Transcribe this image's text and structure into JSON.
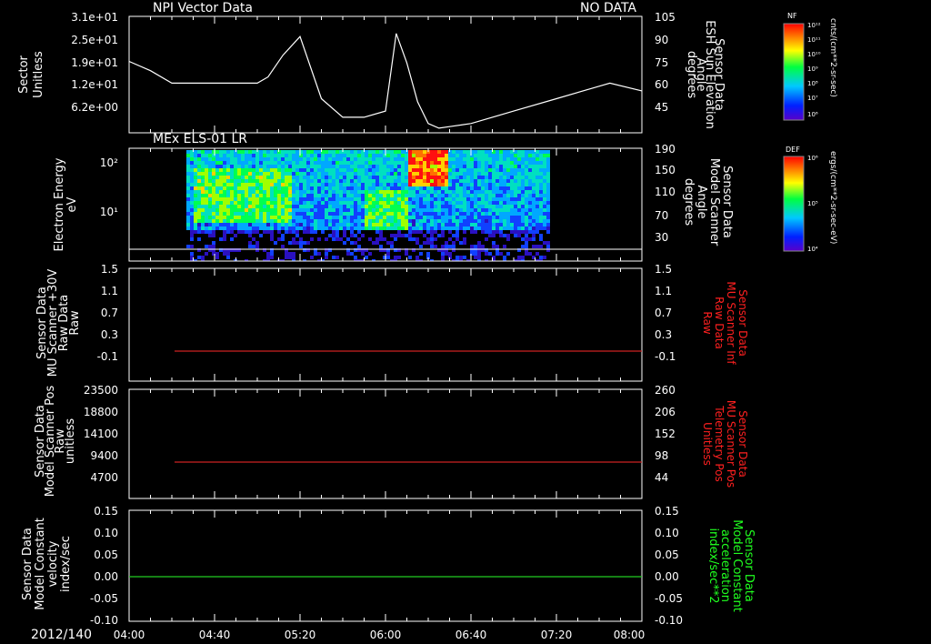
{
  "panel1": {
    "title": "NPI Vector Data",
    "status": "NO DATA",
    "ylabel_left": [
      "Sector",
      "Unitless"
    ],
    "ylabel_right": [
      "Sensor Data",
      "ESH Sun Elevation",
      "Angle",
      "degrees"
    ],
    "yticks_left": [
      "3.1e+01",
      "2.5e+01",
      "1.9e+01",
      "1.2e+01",
      "6.2e+00"
    ],
    "yticks_right": [
      "105",
      "90",
      "75",
      "60",
      "45"
    ],
    "colorbar_label": "NF",
    "colorbar_ticks": [
      "10¹²",
      "10¹¹",
      "10¹⁰",
      "10⁹",
      "10⁸",
      "10⁷",
      "10⁶"
    ],
    "colorbar_unit": "cnts/(cm**2-sr-sec)"
  },
  "panel2": {
    "title": "MEx ELS-01 LR",
    "ylabel_left": [
      "Electron Energy",
      "eV"
    ],
    "ylabel_right": [
      "Sensor Data",
      "Model Scanner",
      "Angle",
      "degrees"
    ],
    "yticks_left": [
      "10²",
      "10¹"
    ],
    "yticks_right": [
      "190",
      "150",
      "110",
      "70",
      "30"
    ],
    "colorbar_label": "DEF",
    "colorbar_ticks": [
      "10⁶",
      "10⁵",
      "10⁴"
    ],
    "colorbar_unit": "ergs/(cm**2-sr-sec-eV)"
  },
  "panel3": {
    "ylabel_left": [
      "Sensor Data",
      "MU Scanner +30V",
      "Raw Data",
      "Raw"
    ],
    "ylabel_right": [
      "Sensor Data",
      "MU Scanner Inf",
      "Raw Data",
      "Raw"
    ],
    "yticks_left": [
      "1.5",
      "1.1",
      "0.7",
      "0.3",
      "-0.1"
    ],
    "yticks_right": [
      "1.5",
      "1.1",
      "0.7",
      "0.3",
      "-0.1"
    ]
  },
  "panel4": {
    "ylabel_left": [
      "Sensor Data",
      "Model Scanner Pos",
      "Raw",
      "unitless"
    ],
    "ylabel_right": [
      "Sensor Data",
      "MU Scanner Pos",
      "Telemetry Pos",
      "Unitless"
    ],
    "yticks_left": [
      "23500",
      "18800",
      "14100",
      "9400",
      "4700"
    ],
    "yticks_right": [
      "260",
      "206",
      "152",
      "98",
      "44"
    ]
  },
  "panel5": {
    "ylabel_left": [
      "Sensor Data",
      "Model Constant",
      "velocity",
      "index/sec"
    ],
    "ylabel_right": [
      "Sensor Data",
      "Model Constant",
      "acceleration",
      "index/sec**2"
    ],
    "yticks_left": [
      "0.15",
      "0.10",
      "0.05",
      "0.00",
      "-0.05",
      "-0.10"
    ],
    "yticks_right": [
      "0.15",
      "0.10",
      "0.05",
      "0.00",
      "-0.05",
      "-0.10"
    ]
  },
  "xaxis": {
    "date": "2012/140",
    "ticks": [
      "04:00",
      "04:40",
      "05:20",
      "06:00",
      "06:40",
      "07:20",
      "08:00"
    ]
  },
  "colors": {
    "right_red": "#ff2020",
    "right_green": "#20ff20",
    "trace_red": "#cc2222",
    "trace_green": "#22cc22"
  },
  "chart_data": [
    {
      "type": "line",
      "title": "NPI Vector Data",
      "series": [
        {
          "x": [
            "04:00",
            "04:10",
            "04:20",
            "04:40",
            "05:00",
            "05:05",
            "05:12",
            "05:20",
            "05:30",
            "05:40",
            "05:50",
            "06:00",
            "06:05",
            "06:10",
            "06:15",
            "06:20",
            "06:25",
            "06:30",
            "06:40",
            "07:00",
            "07:20",
            "07:40",
            "07:45",
            "08:00"
          ],
          "values": [
            76,
            70,
            62,
            62,
            62,
            66,
            80,
            92,
            52,
            40,
            40,
            44,
            94,
            75,
            50,
            36,
            33,
            34,
            36,
            44,
            52,
            60,
            62,
            57
          ]
        }
      ],
      "ylim": [
        30,
        105
      ]
    },
    {
      "type": "heatmap",
      "title": "MEx ELS-01 LR",
      "ylabel": "Electron Energy eV",
      "xlim": [
        "04:30",
        "07:20"
      ],
      "features": [
        {
          "x": [
            "04:30",
            "05:15"
          ],
          "level": "medium-high",
          "energy_eV": [
            3,
            60
          ]
        },
        {
          "x": [
            "05:50",
            "06:10"
          ],
          "level": "medium",
          "energy_eV": [
            3,
            30
          ]
        },
        {
          "x": [
            "06:10",
            "06:28"
          ],
          "level": "high",
          "energy_eV": [
            50,
            150
          ]
        }
      ]
    },
    {
      "type": "line",
      "series": [
        {
          "x": [
            "04:20",
            "08:00"
          ],
          "values": [
            0,
            0
          ]
        }
      ],
      "ylim": [
        -0.2,
        1.5
      ]
    },
    {
      "type": "line",
      "series": [
        {
          "x": [
            "04:20",
            "08:00"
          ],
          "values": [
            104,
            104
          ]
        }
      ],
      "ylim": [
        0,
        260
      ]
    },
    {
      "type": "line",
      "series": [
        {
          "x": [
            "04:00",
            "08:00"
          ],
          "values": [
            0.0,
            0.0
          ]
        }
      ],
      "ylim": [
        -0.1,
        0.15
      ]
    }
  ]
}
